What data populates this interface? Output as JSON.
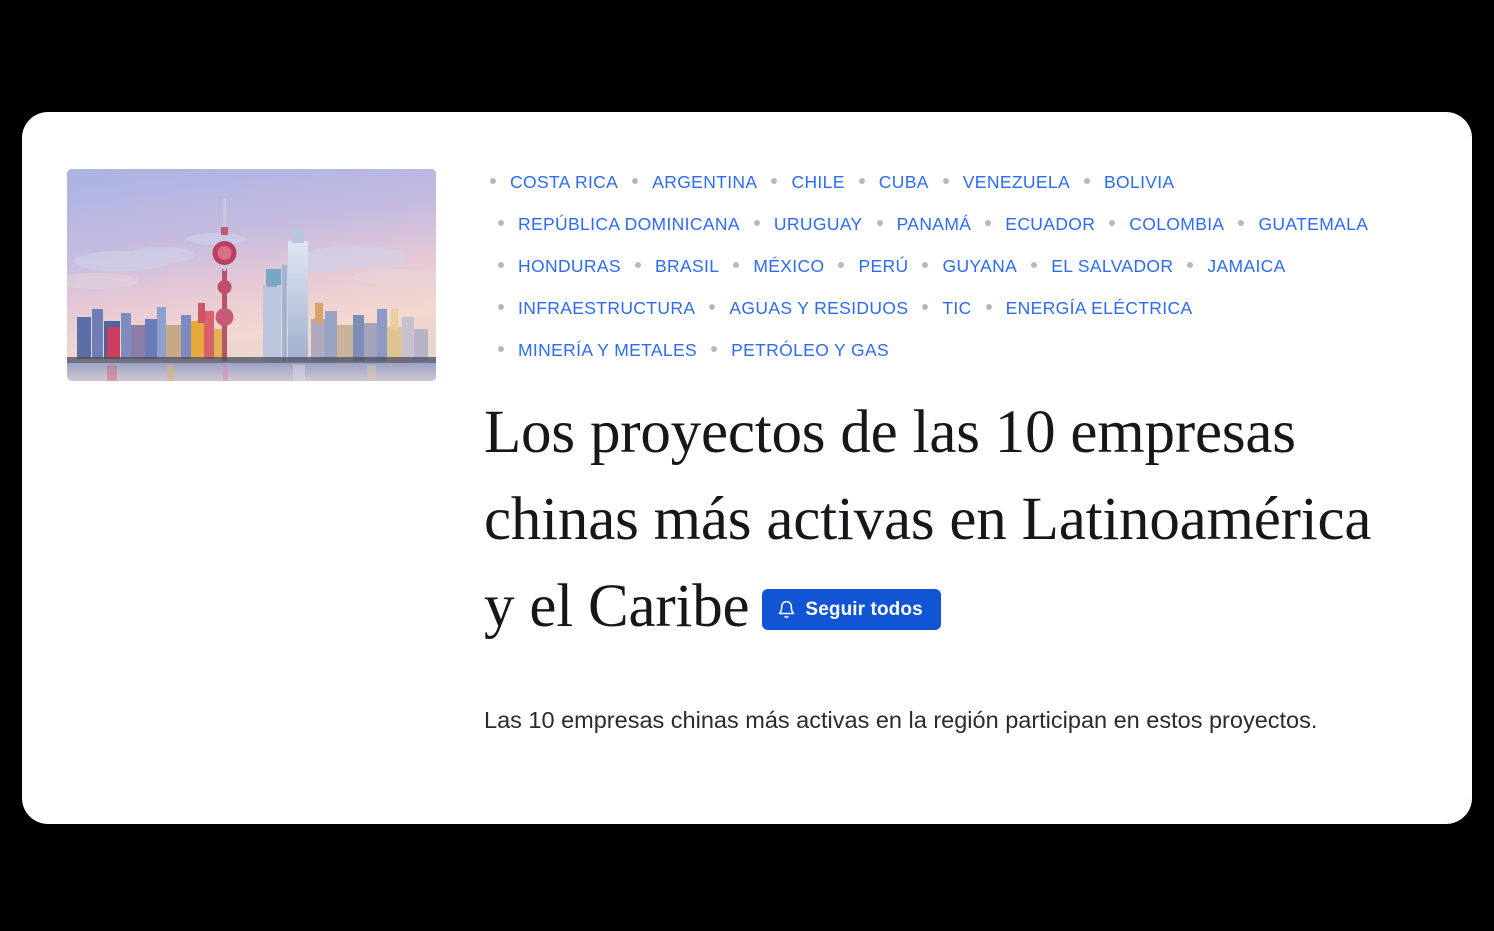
{
  "card": {
    "thumbnail": {
      "alt": "Shanghai Pudong skyline at dusk",
      "icon": "city-skyline-image"
    },
    "tags": [
      {
        "label": "COSTA RICA"
      },
      {
        "label": "ARGENTINA"
      },
      {
        "label": "CHILE"
      },
      {
        "label": "CUBA"
      },
      {
        "label": "VENEZUELA"
      },
      {
        "label": "BOLIVIA"
      },
      {
        "label": "REPÚBLICA DOMINICANA"
      },
      {
        "label": "URUGUAY"
      },
      {
        "label": "PANAMÁ"
      },
      {
        "label": "ECUADOR"
      },
      {
        "label": "COLOMBIA"
      },
      {
        "label": "GUATEMALA"
      },
      {
        "label": "HONDURAS"
      },
      {
        "label": "BRASIL"
      },
      {
        "label": "MÉXICO"
      },
      {
        "label": "PERÚ"
      },
      {
        "label": "GUYANA"
      },
      {
        "label": "EL SALVADOR"
      },
      {
        "label": "JAMAICA"
      },
      {
        "label": "INFRAESTRUCTURA"
      },
      {
        "label": "AGUAS Y RESIDUOS"
      },
      {
        "label": "TIC"
      },
      {
        "label": "ENERGÍA ELÉCTRICA"
      },
      {
        "label": "MINERÍA Y METALES"
      },
      {
        "label": "PETRÓLEO Y GAS"
      }
    ],
    "headline": "Los proyectos de las 10 empresas chinas más activas en Latinoamérica y el Caribe",
    "follow_button": {
      "label": "Seguir todos",
      "icon": "bell-icon"
    },
    "summary": "Las 10 empresas chinas más activas en la región participan en estos proyectos."
  },
  "colors": {
    "page_background": "#000000",
    "card_background": "#ffffff",
    "tag_link": "#2d6bf5",
    "tag_bullet": "#b9b9bd",
    "button_background": "#1155d4",
    "button_text": "#ffffff",
    "headline_text": "#15171a",
    "summary_text": "#2b2b2f"
  }
}
